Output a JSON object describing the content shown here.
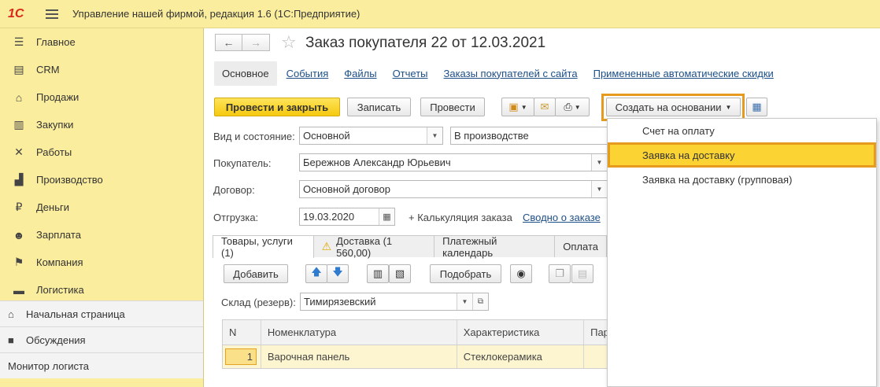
{
  "titlebar": {
    "logo": "1С",
    "title": "Управление нашей фирмой, редакция 1.6  (1С:Предприятие)"
  },
  "sidebar": {
    "items": [
      {
        "label": "Главное",
        "icon": "list-icon"
      },
      {
        "label": "CRM",
        "icon": "crm-icon"
      },
      {
        "label": "Продажи",
        "icon": "basket-icon"
      },
      {
        "label": "Закупки",
        "icon": "barcode-icon"
      },
      {
        "label": "Работы",
        "icon": "tools-icon"
      },
      {
        "label": "Производство",
        "icon": "factory-icon"
      },
      {
        "label": "Деньги",
        "icon": "ruble-icon"
      },
      {
        "label": "Зарплата",
        "icon": "people-icon"
      },
      {
        "label": "Компания",
        "icon": "flag-icon"
      },
      {
        "label": "Логистика",
        "icon": "truck-icon"
      }
    ],
    "bottom": [
      {
        "label": "Начальная страница",
        "icon": "home-icon"
      },
      {
        "label": "Обсуждения",
        "icon": "chat-icon"
      },
      {
        "label": "Монитор логиста",
        "icon": ""
      }
    ]
  },
  "doc": {
    "title": "Заказ покупателя 22 от 12.03.2021",
    "tabs": [
      "Основное",
      "События",
      "Файлы",
      "Отчеты",
      "Заказы покупателей с сайта",
      "Примененные автоматические скидки"
    ]
  },
  "toolbar": {
    "post_close": "Провести и закрыть",
    "save": "Записать",
    "post": "Провести",
    "create_based": "Создать на основании"
  },
  "form": {
    "kind_label": "Вид и состояние:",
    "kind_value": "Основной",
    "state_value": "В производстве",
    "buyer_label": "Покупатель:",
    "buyer_value": "Бережнов Александр Юрьевич",
    "contract_label": "Договор:",
    "contract_value": "Основной договор",
    "ship_label": "Отгрузка:",
    "ship_value": "19.03.2020",
    "calc_link": "+ Калькуляция заказа",
    "summary_link": "Сводно о заказе"
  },
  "subtabs": [
    "Товары, услуги (1)",
    "Доставка (1 560,00)",
    "Платежный календарь",
    "Оплата"
  ],
  "table_toolbar": {
    "add": "Добавить",
    "pick": "Подобрать"
  },
  "warehouse": {
    "label": "Склад (резерв):",
    "value": "Тимирязевский"
  },
  "table": {
    "headers": [
      "N",
      "Номенклатура",
      "Характеристика",
      "Пар"
    ],
    "rows": [
      {
        "n": "1",
        "item": "Варочная панель",
        "char": "Стеклокерамика"
      }
    ]
  },
  "popup": {
    "items": [
      "Счет на оплату",
      "Заявка на доставку",
      "Заявка на доставку (групповая)"
    ],
    "highlighted": 1
  },
  "colors": {
    "accent_yellow": "#fbed9e",
    "highlight_orange": "#e69b1f",
    "menu_highlight": "#fbd332",
    "link": "#1c4f88"
  }
}
